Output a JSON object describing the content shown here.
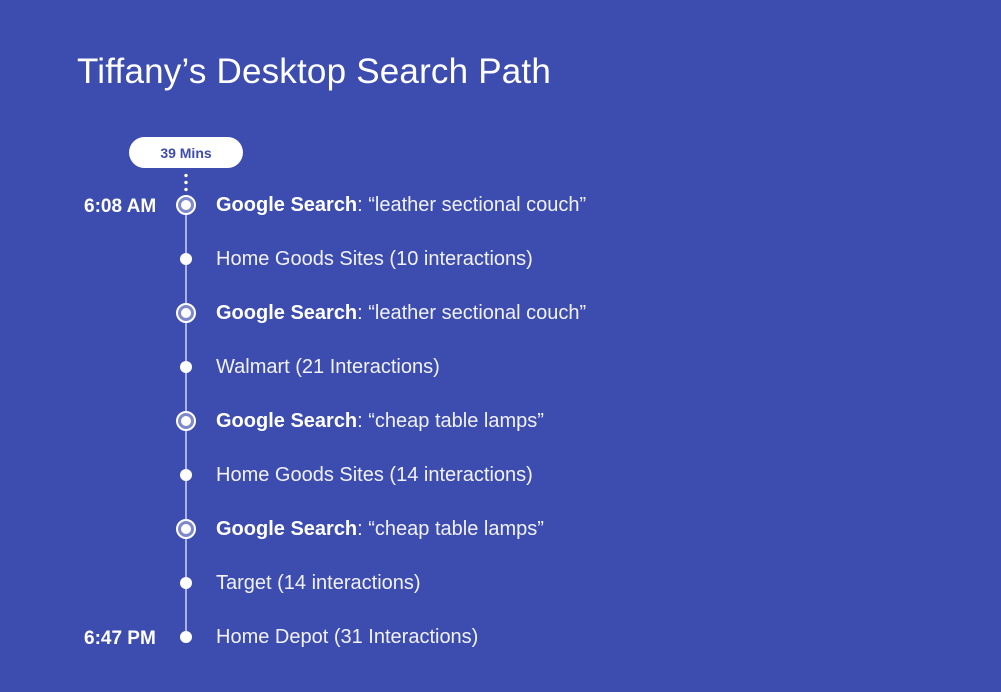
{
  "title": "Tiffany’s Desktop Search Path",
  "duration": "39 Mins",
  "start_time": "6:08 AM",
  "end_time": "6:47 PM",
  "steps": [
    {
      "type": "search",
      "label": "Google Search",
      "text": ": “leather sectional couch”"
    },
    {
      "type": "site",
      "label": "",
      "text": "Home Goods Sites (10 interactions)"
    },
    {
      "type": "search",
      "label": "Google Search",
      "text": ": “leather sectional couch”"
    },
    {
      "type": "site",
      "label": "",
      "text": "Walmart (21 Interactions)"
    },
    {
      "type": "search",
      "label": "Google Search",
      "text": ": “cheap table lamps”"
    },
    {
      "type": "site",
      "label": "",
      "text": "Home Goods Sites (14 interactions)"
    },
    {
      "type": "search",
      "label": "Google Search",
      "text": ": “cheap table lamps”"
    },
    {
      "type": "site",
      "label": "",
      "text": "Target (14 interactions)"
    },
    {
      "type": "site",
      "label": "",
      "text": "Home Depot (31 Interactions)"
    }
  ],
  "colors": {
    "background": "#3d4caf",
    "timeline_line": "#aab2e3",
    "node": "#ffffff"
  }
}
